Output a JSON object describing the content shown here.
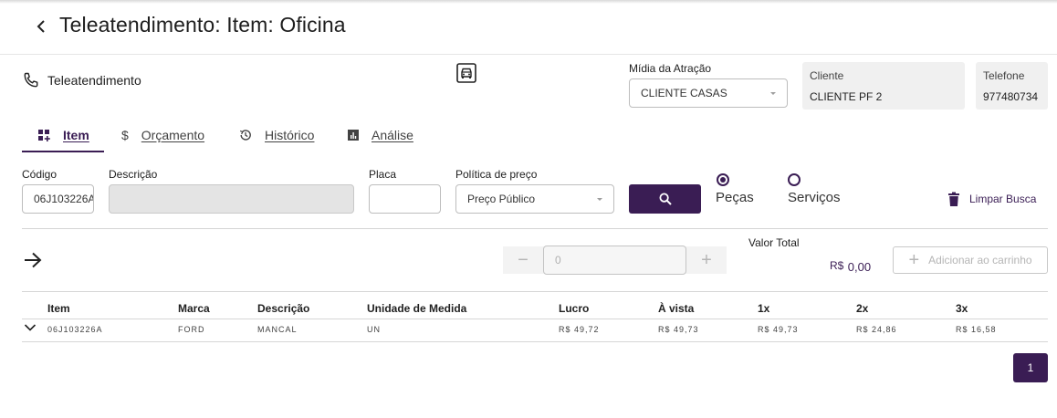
{
  "header": {
    "title": "Teleatendimento: Item: Oficina"
  },
  "section": {
    "label": "Teleatendimento"
  },
  "midia": {
    "label": "Mídia da Atração",
    "value": "CLIENTE CASAS"
  },
  "cliente": {
    "label": "Cliente",
    "value": "CLIENTE PF 2"
  },
  "telefone": {
    "label": "Telefone",
    "value": "977480734"
  },
  "tabs": [
    {
      "label": "Item",
      "icon": "grid-add-icon",
      "active": true
    },
    {
      "label": "Orçamento",
      "icon": "dollar-icon",
      "active": false
    },
    {
      "label": "Histórico",
      "icon": "history-icon",
      "active": false
    },
    {
      "label": "Análise",
      "icon": "chart-icon",
      "active": false
    }
  ],
  "search": {
    "codigo_label": "Código",
    "codigo_value": "06J103226A",
    "descricao_label": "Descrição",
    "descricao_value": "",
    "placa_label": "Placa",
    "placa_value": "",
    "politica_label": "Política de preço",
    "politica_value": "Preço Público",
    "radio_pecas": "Peças",
    "radio_servicos": "Serviços",
    "selected_radio": "pecas",
    "clear_label": "Limpar Busca"
  },
  "cart": {
    "quantity": "0",
    "total_label": "Valor Total",
    "total_currency": "R$",
    "total_value": "0,00",
    "add_label": "Adicionar ao carrinho"
  },
  "table": {
    "headers": [
      "Item",
      "Marca",
      "Descrição",
      "Unidade de Medida",
      "Lucro",
      "À vista",
      "1x",
      "2x",
      "3x"
    ],
    "rows": [
      [
        "06J103226A",
        "FORD",
        "MANCAL",
        "UN",
        "R$ 49,72",
        "R$ 49,73",
        "R$ 49,73",
        "R$ 24,86",
        "R$ 16,58"
      ]
    ]
  },
  "pagination": {
    "current": "1"
  },
  "colors": {
    "primary": "#3a1d54",
    "disabled": "#b5b5b5"
  }
}
